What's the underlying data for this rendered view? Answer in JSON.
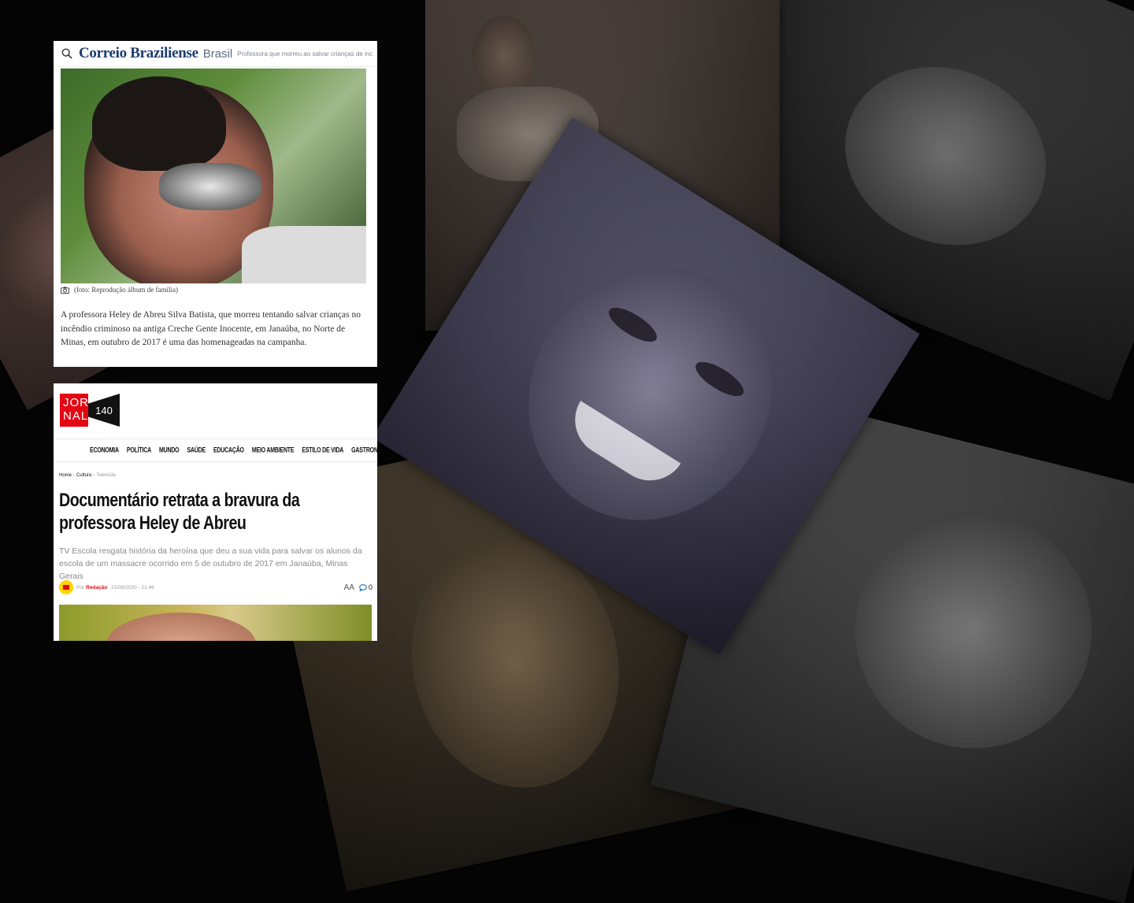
{
  "collage": {
    "tiles": [
      "kid-photo",
      "woman-portrait-right",
      "woman-portrait-left",
      "woman-portrait-bottom-left",
      "woman-portrait-bottom-right",
      "woman-portrait-center"
    ]
  },
  "correio": {
    "logo": "Correio Braziliense",
    "section": "Brasil",
    "headline": "Professora que morreu ao salvar crianças de inc",
    "caption": "(foto: Reprodução álbum de família)",
    "body": "A professora Heley de Abreu Silva Batista, que morreu tentando salvar crianças no incêndio criminoso na antiga Creche Gente Inocente, em Janaúba, no Norte de Minas, em outubro de 2017 é uma das homenageadas na campanha."
  },
  "jornal": {
    "logo_line1": "JOR",
    "logo_line2": "NAL",
    "logo_number": "140",
    "nav": [
      "ECONOMIA",
      "POLÍTICA",
      "MUNDO",
      "SAÚDE",
      "EDUCAÇÃO",
      "MEIO AMBIENTE",
      "ESTILO DE VIDA",
      "GASTRONOMIA"
    ],
    "breadcrumb": {
      "home": "Home",
      "section": "Cultura",
      "current": "Televisão"
    },
    "title": "Documentário retrata a bravura da professora Heley de Abreu",
    "subtitle": "TV Escola resgata história da heroína que deu a sua vida para salvar os alunos da escola de um massacre ocorrido em 5 de outubro de 2017 em Janaúba, Minas Gerais",
    "meta": {
      "by": "Por",
      "author": "Redação",
      "date": "21/09/2020 - 21:46",
      "font_size_label": "AA",
      "comments": "0"
    }
  },
  "colors": {
    "accent_red": "#e30613",
    "correio_blue": "#1d3b6f",
    "link_blue": "#1e73be"
  }
}
